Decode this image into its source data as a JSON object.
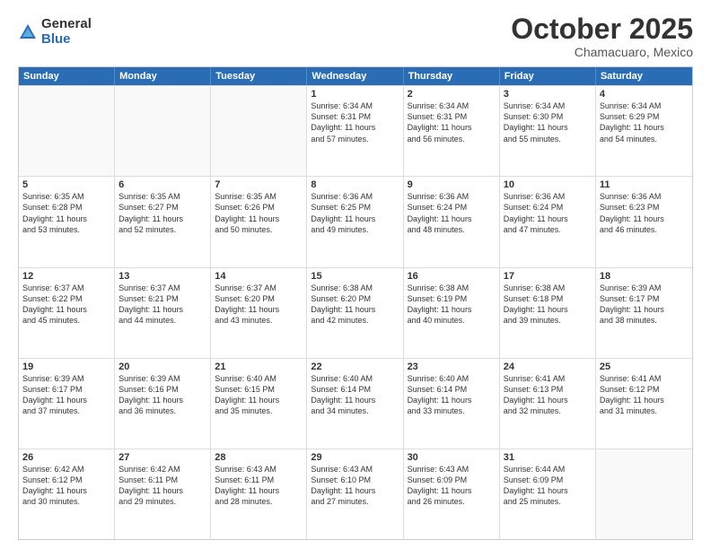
{
  "logo": {
    "general": "General",
    "blue": "Blue"
  },
  "title": "October 2025",
  "location": "Chamacuaro, Mexico",
  "headers": [
    "Sunday",
    "Monday",
    "Tuesday",
    "Wednesday",
    "Thursday",
    "Friday",
    "Saturday"
  ],
  "rows": [
    [
      {
        "day": "",
        "lines": []
      },
      {
        "day": "",
        "lines": []
      },
      {
        "day": "",
        "lines": []
      },
      {
        "day": "1",
        "lines": [
          "Sunrise: 6:34 AM",
          "Sunset: 6:31 PM",
          "Daylight: 11 hours",
          "and 57 minutes."
        ]
      },
      {
        "day": "2",
        "lines": [
          "Sunrise: 6:34 AM",
          "Sunset: 6:31 PM",
          "Daylight: 11 hours",
          "and 56 minutes."
        ]
      },
      {
        "day": "3",
        "lines": [
          "Sunrise: 6:34 AM",
          "Sunset: 6:30 PM",
          "Daylight: 11 hours",
          "and 55 minutes."
        ]
      },
      {
        "day": "4",
        "lines": [
          "Sunrise: 6:34 AM",
          "Sunset: 6:29 PM",
          "Daylight: 11 hours",
          "and 54 minutes."
        ]
      }
    ],
    [
      {
        "day": "5",
        "lines": [
          "Sunrise: 6:35 AM",
          "Sunset: 6:28 PM",
          "Daylight: 11 hours",
          "and 53 minutes."
        ]
      },
      {
        "day": "6",
        "lines": [
          "Sunrise: 6:35 AM",
          "Sunset: 6:27 PM",
          "Daylight: 11 hours",
          "and 52 minutes."
        ]
      },
      {
        "day": "7",
        "lines": [
          "Sunrise: 6:35 AM",
          "Sunset: 6:26 PM",
          "Daylight: 11 hours",
          "and 50 minutes."
        ]
      },
      {
        "day": "8",
        "lines": [
          "Sunrise: 6:36 AM",
          "Sunset: 6:25 PM",
          "Daylight: 11 hours",
          "and 49 minutes."
        ]
      },
      {
        "day": "9",
        "lines": [
          "Sunrise: 6:36 AM",
          "Sunset: 6:24 PM",
          "Daylight: 11 hours",
          "and 48 minutes."
        ]
      },
      {
        "day": "10",
        "lines": [
          "Sunrise: 6:36 AM",
          "Sunset: 6:24 PM",
          "Daylight: 11 hours",
          "and 47 minutes."
        ]
      },
      {
        "day": "11",
        "lines": [
          "Sunrise: 6:36 AM",
          "Sunset: 6:23 PM",
          "Daylight: 11 hours",
          "and 46 minutes."
        ]
      }
    ],
    [
      {
        "day": "12",
        "lines": [
          "Sunrise: 6:37 AM",
          "Sunset: 6:22 PM",
          "Daylight: 11 hours",
          "and 45 minutes."
        ]
      },
      {
        "day": "13",
        "lines": [
          "Sunrise: 6:37 AM",
          "Sunset: 6:21 PM",
          "Daylight: 11 hours",
          "and 44 minutes."
        ]
      },
      {
        "day": "14",
        "lines": [
          "Sunrise: 6:37 AM",
          "Sunset: 6:20 PM",
          "Daylight: 11 hours",
          "and 43 minutes."
        ]
      },
      {
        "day": "15",
        "lines": [
          "Sunrise: 6:38 AM",
          "Sunset: 6:20 PM",
          "Daylight: 11 hours",
          "and 42 minutes."
        ]
      },
      {
        "day": "16",
        "lines": [
          "Sunrise: 6:38 AM",
          "Sunset: 6:19 PM",
          "Daylight: 11 hours",
          "and 40 minutes."
        ]
      },
      {
        "day": "17",
        "lines": [
          "Sunrise: 6:38 AM",
          "Sunset: 6:18 PM",
          "Daylight: 11 hours",
          "and 39 minutes."
        ]
      },
      {
        "day": "18",
        "lines": [
          "Sunrise: 6:39 AM",
          "Sunset: 6:17 PM",
          "Daylight: 11 hours",
          "and 38 minutes."
        ]
      }
    ],
    [
      {
        "day": "19",
        "lines": [
          "Sunrise: 6:39 AM",
          "Sunset: 6:17 PM",
          "Daylight: 11 hours",
          "and 37 minutes."
        ]
      },
      {
        "day": "20",
        "lines": [
          "Sunrise: 6:39 AM",
          "Sunset: 6:16 PM",
          "Daylight: 11 hours",
          "and 36 minutes."
        ]
      },
      {
        "day": "21",
        "lines": [
          "Sunrise: 6:40 AM",
          "Sunset: 6:15 PM",
          "Daylight: 11 hours",
          "and 35 minutes."
        ]
      },
      {
        "day": "22",
        "lines": [
          "Sunrise: 6:40 AM",
          "Sunset: 6:14 PM",
          "Daylight: 11 hours",
          "and 34 minutes."
        ]
      },
      {
        "day": "23",
        "lines": [
          "Sunrise: 6:40 AM",
          "Sunset: 6:14 PM",
          "Daylight: 11 hours",
          "and 33 minutes."
        ]
      },
      {
        "day": "24",
        "lines": [
          "Sunrise: 6:41 AM",
          "Sunset: 6:13 PM",
          "Daylight: 11 hours",
          "and 32 minutes."
        ]
      },
      {
        "day": "25",
        "lines": [
          "Sunrise: 6:41 AM",
          "Sunset: 6:12 PM",
          "Daylight: 11 hours",
          "and 31 minutes."
        ]
      }
    ],
    [
      {
        "day": "26",
        "lines": [
          "Sunrise: 6:42 AM",
          "Sunset: 6:12 PM",
          "Daylight: 11 hours",
          "and 30 minutes."
        ]
      },
      {
        "day": "27",
        "lines": [
          "Sunrise: 6:42 AM",
          "Sunset: 6:11 PM",
          "Daylight: 11 hours",
          "and 29 minutes."
        ]
      },
      {
        "day": "28",
        "lines": [
          "Sunrise: 6:43 AM",
          "Sunset: 6:11 PM",
          "Daylight: 11 hours",
          "and 28 minutes."
        ]
      },
      {
        "day": "29",
        "lines": [
          "Sunrise: 6:43 AM",
          "Sunset: 6:10 PM",
          "Daylight: 11 hours",
          "and 27 minutes."
        ]
      },
      {
        "day": "30",
        "lines": [
          "Sunrise: 6:43 AM",
          "Sunset: 6:09 PM",
          "Daylight: 11 hours",
          "and 26 minutes."
        ]
      },
      {
        "day": "31",
        "lines": [
          "Sunrise: 6:44 AM",
          "Sunset: 6:09 PM",
          "Daylight: 11 hours",
          "and 25 minutes."
        ]
      },
      {
        "day": "",
        "lines": []
      }
    ]
  ]
}
